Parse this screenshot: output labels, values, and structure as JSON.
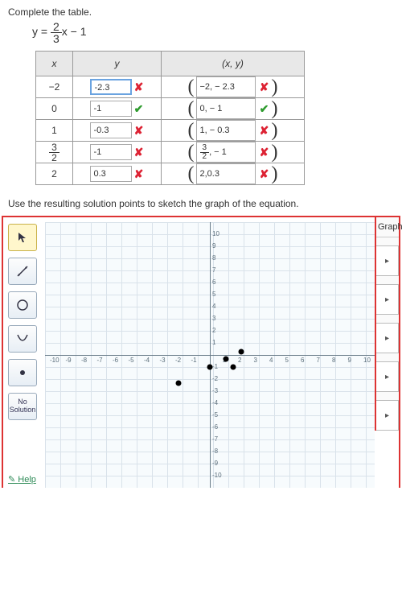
{
  "prompt1": "Complete the table.",
  "equation": {
    "lhs": "y = ",
    "num": "2",
    "den": "3",
    "rest": "x − 1"
  },
  "headers": {
    "x": "x",
    "y": "y",
    "xy": "(x, y)"
  },
  "rows": [
    {
      "x": "−2",
      "y": "-2.3",
      "y_ok": false,
      "xy_text": "−2, − 2.3",
      "xy_ok": false
    },
    {
      "x": "0",
      "y": "-1",
      "y_ok": true,
      "xy_text": "0, − 1",
      "xy_ok": true
    },
    {
      "x": "1",
      "y": "-0.3",
      "y_ok": false,
      "xy_text": "1, − 0.3",
      "xy_ok": false
    },
    {
      "x": "",
      "x_frac": {
        "n": "3",
        "d": "2"
      },
      "y": "-1",
      "y_ok": false,
      "xy_frac": {
        "n": "3",
        "d": "2"
      },
      "xy_rest": ", − 1",
      "xy_ok": false
    },
    {
      "x": "2",
      "y": "0.3",
      "y_ok": false,
      "xy_text": "2,0.3",
      "xy_ok": false
    }
  ],
  "prompt2": "Use the resulting solution points to sketch the graph of the equation.",
  "tools": {
    "no_solution": "No\nSolution"
  },
  "side_header": "Graph",
  "help": "Help",
  "marks": {
    "ok": "✔",
    "bad": "✘"
  },
  "chart_data": {
    "type": "scatter",
    "xlim": [
      -10,
      10
    ],
    "ylim": [
      -10,
      10
    ],
    "xticks": [
      -10,
      -9,
      -8,
      -7,
      -6,
      -5,
      -4,
      -3,
      -2,
      -1,
      1,
      2,
      3,
      4,
      5,
      6,
      7,
      8,
      9,
      10
    ],
    "yticks": [
      -10,
      -9,
      -8,
      -7,
      -6,
      -5,
      -4,
      -3,
      -2,
      -1,
      1,
      2,
      3,
      4,
      5,
      6,
      7,
      8,
      9,
      10
    ],
    "points": [
      {
        "x": -2,
        "y": -2.3
      },
      {
        "x": 0,
        "y": -1
      },
      {
        "x": 1,
        "y": -0.3
      },
      {
        "x": 1.5,
        "y": -1
      },
      {
        "x": 2,
        "y": 0.3
      }
    ]
  }
}
